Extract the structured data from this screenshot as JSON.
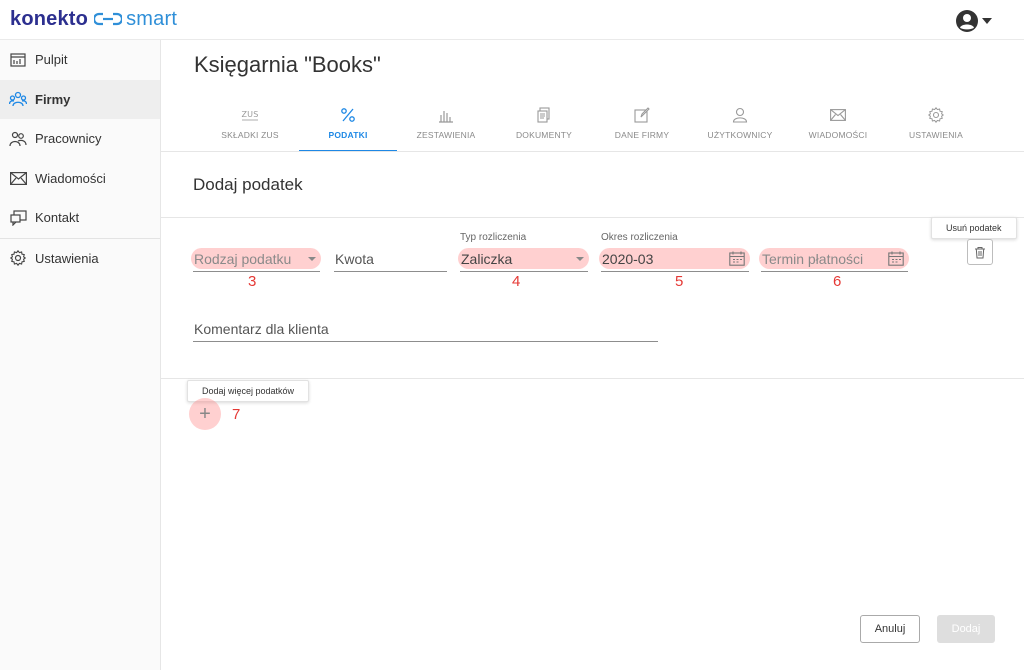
{
  "app": {
    "logo_word1": "konekto",
    "logo_word2": "smart",
    "brand_color": "#2c2f8f",
    "accent_color": "#1e88e5"
  },
  "sidebar": {
    "items": [
      {
        "label": "Pulpit",
        "icon": "dashboard-icon"
      },
      {
        "label": "Firmy",
        "icon": "companies-icon",
        "active": true
      },
      {
        "label": "Pracownicy",
        "icon": "employees-icon"
      },
      {
        "label": "Wiadomości",
        "icon": "mail-icon"
      },
      {
        "label": "Kontakt",
        "icon": "contact-icon"
      },
      {
        "label": "Ustawienia",
        "icon": "gear-icon"
      }
    ]
  },
  "main": {
    "company_title": "Księgarnia \"Books\"",
    "tabs": [
      {
        "label": "SKŁADKI ZUS",
        "icon": "zus-icon"
      },
      {
        "label": "PODATKI",
        "icon": "percent-icon",
        "active": true
      },
      {
        "label": "ZESTAWIENIA",
        "icon": "bar-chart-icon"
      },
      {
        "label": "DOKUMENTY",
        "icon": "documents-icon"
      },
      {
        "label": "DANE FIRMY",
        "icon": "edit-icon"
      },
      {
        "label": "UŻYTKOWNICY",
        "icon": "user-icon"
      },
      {
        "label": "WIADOMOŚCI",
        "icon": "mail-icon"
      },
      {
        "label": "USTAWIENIA",
        "icon": "gear-icon"
      }
    ],
    "section_title": "Dodaj podatek",
    "form": {
      "tax_type_placeholder": "Rodzaj podatku",
      "amount_placeholder": "Kwota",
      "settlement_type_label": "Typ rozliczenia",
      "settlement_type_value": "Zaliczka",
      "period_label": "Okres rozliczenia",
      "period_value": "2020-03",
      "due_date_placeholder": "Termin płatności",
      "comment_placeholder": "Komentarz dla klienta"
    },
    "annotations": {
      "n3": "3",
      "n4": "4",
      "n5": "5",
      "n6": "6",
      "n7": "7"
    },
    "remove_tax_tooltip": "Usuń podatek",
    "add_more_tooltip": "Dodaj więcej podatków",
    "add_more_symbol": "+",
    "cancel_label": "Anuluj",
    "submit_label": "Dodaj"
  }
}
